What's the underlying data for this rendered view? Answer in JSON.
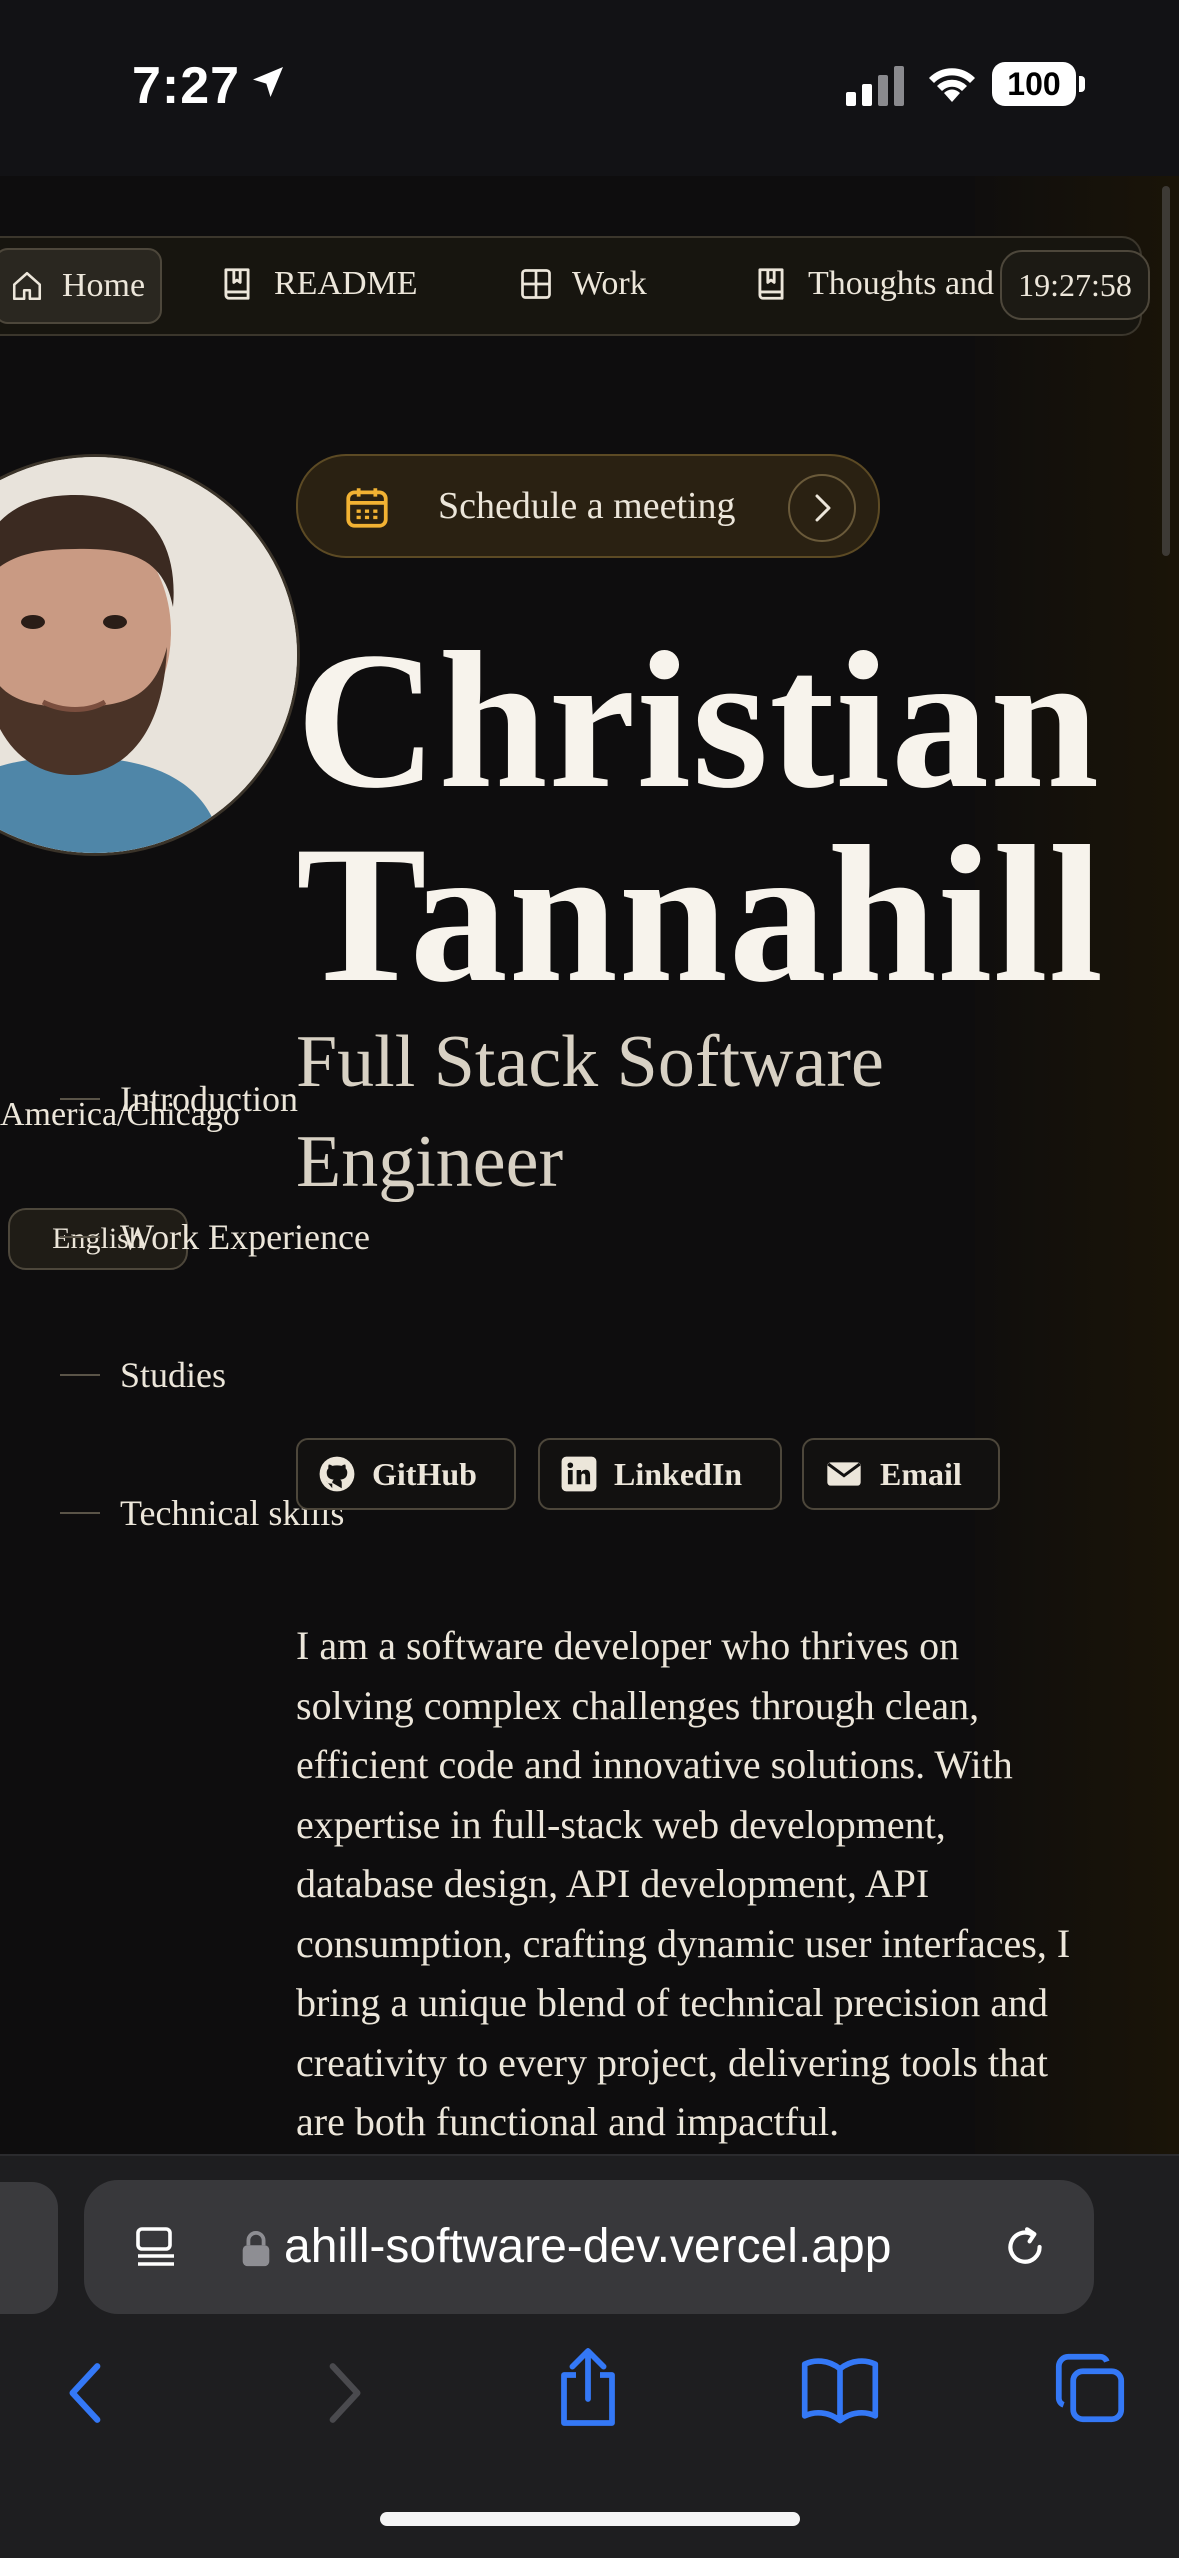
{
  "status_bar": {
    "time": "7:27",
    "battery": "100"
  },
  "nav": {
    "items": [
      "Home",
      "README",
      "Work",
      "Thoughts and"
    ],
    "time": "19:27:58"
  },
  "left": {
    "timezone": "America/Chicago",
    "language": "English",
    "toc": [
      "Introduction",
      "Work Experience",
      "Studies",
      "Technical skills"
    ]
  },
  "hero": {
    "schedule_label": "Schedule a meeting",
    "name_first": "Christian",
    "name_last": "Tannahill",
    "role": "Full Stack Software Engineer"
  },
  "social": {
    "github": "GitHub",
    "linkedin": "LinkedIn",
    "email": "Email"
  },
  "bio": "I am a software developer who thrives on solving complex challenges through clean, efficient code and innovative solutions. With expertise in full-stack web development, database design, API development, API consumption, crafting dynamic user interfaces, I bring a unique blend of technical precision and creativity to every project, delivering tools that are both functional and impactful.",
  "browser": {
    "url": "ahill-software-dev.vercel.app"
  },
  "colors": {
    "accent": "#f2b233",
    "background": "#0e0d0e",
    "safari_blue": "#3478f6"
  }
}
